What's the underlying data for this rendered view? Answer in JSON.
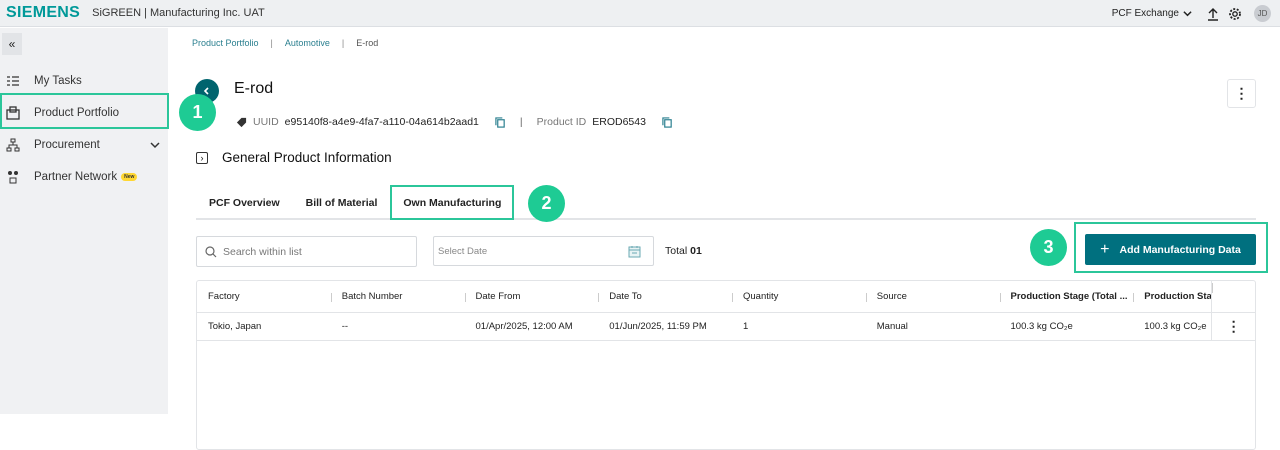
{
  "header": {
    "logo": "SIEMENS",
    "app_title": "SiGREEN | Manufacturing Inc. UAT",
    "exchange_label": "PCF Exchange",
    "avatar_initials": "JD"
  },
  "sidebar": {
    "items": [
      {
        "label": "My Tasks"
      },
      {
        "label": "Product Portfolio"
      },
      {
        "label": "Procurement"
      },
      {
        "label": "Partner Network",
        "badge": "New"
      }
    ]
  },
  "breadcrumb": [
    "Product Portfolio",
    "Automotive",
    "E-rod"
  ],
  "product": {
    "title": "E-rod",
    "uuid_label": "UUID",
    "uuid": "e95140f8-a4e9-4fa7-a110-04a614b2aad1",
    "product_id_label": "Product ID",
    "product_id": "EROD6543"
  },
  "section": {
    "general_info": "General Product Information"
  },
  "tabs": [
    {
      "label": "PCF Overview"
    },
    {
      "label": "Bill of Material"
    },
    {
      "label": "Own Manufacturing",
      "active": true
    }
  ],
  "toolbar": {
    "search_placeholder": "Search within list",
    "date_placeholder": "Select Date",
    "total_label": "Total",
    "total_value": "01",
    "add_button": "Add Manufacturing Data"
  },
  "table": {
    "columns": [
      "Factory",
      "Batch Number",
      "Date From",
      "Date To",
      "Quantity",
      "Source",
      "Production Stage (Total ...",
      "Production Sta"
    ],
    "rows": [
      [
        "Tokio, Japan",
        "--",
        "01/Apr/2025, 12:00 AM",
        "01/Jun/2025, 11:59 PM",
        "1",
        "Manual",
        "100.3 kg CO₂e",
        "100.3 kg CO₂e"
      ]
    ]
  },
  "callouts": [
    "1",
    "2",
    "3"
  ],
  "colors": {
    "brand": "#009999",
    "primary": "#00707f",
    "callout": "#1ecb94"
  }
}
